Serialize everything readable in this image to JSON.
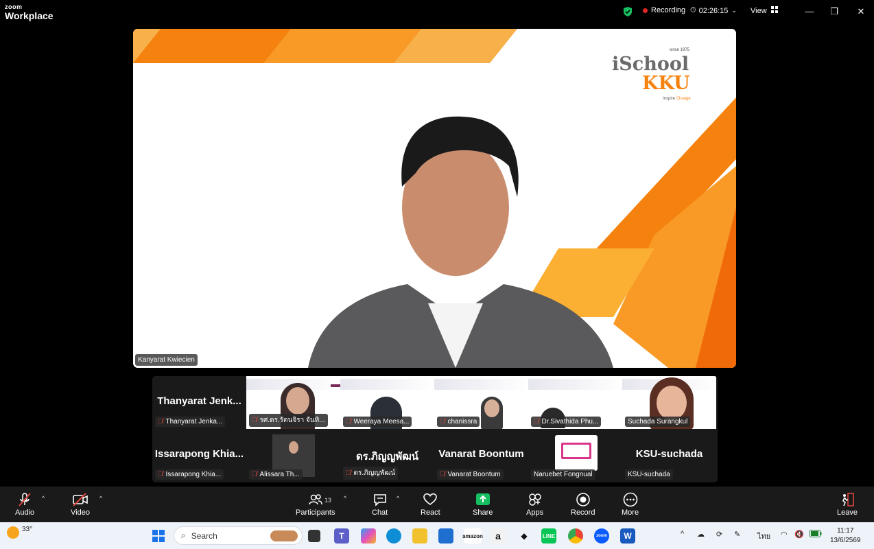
{
  "app": {
    "logo_small": "zoom",
    "logo_big": "Workplace"
  },
  "titlebar": {
    "recording_label": "Recording",
    "timer": "02:26:15",
    "view_label": "View",
    "security_icon": "shield-check-icon"
  },
  "stage": {
    "speaker_name": "Kanyarat Kwiecien",
    "banner": {
      "since": "since 1975",
      "brand1": "iSchool",
      "brand2": "KKU",
      "tagline_a": "Inspire ",
      "tagline_b": "Change"
    }
  },
  "gallery": {
    "tiles": [
      {
        "big": "Thanyarat  Jenk...",
        "label": "Thanyarat  Jenka..."
      },
      {
        "label": "รศ.ดร.รัตนจิรา จันทิ..."
      },
      {
        "label": "Weeraya Meesa..."
      },
      {
        "label": "chanissra"
      },
      {
        "label": "Dr.Sivathida Phu..."
      },
      {
        "label": "Suchada Surangkul"
      },
      {
        "big": "Issarapong  Khia...",
        "label": "Issarapong Khia..."
      },
      {
        "label": "Alissara Th..."
      },
      {
        "big": "ดร.ภิญญพัฒน์",
        "label": "ดร.ภิญญพัฒน์"
      },
      {
        "big": "Vanarat Boontum",
        "label": "Vanarat Boontum"
      },
      {
        "label": "Naruebet Fongnual"
      },
      {
        "big": "KSU-suchada",
        "label": "KSU-suchada"
      }
    ]
  },
  "toolbar": {
    "audio": "Audio",
    "video": "Video",
    "participants": "Participants",
    "participants_count": "13",
    "chat": "Chat",
    "react": "React",
    "share": "Share",
    "apps": "Apps",
    "record": "Record",
    "more": "More",
    "leave": "Leave"
  },
  "taskbar": {
    "temperature": "33°",
    "search_placeholder": "Search",
    "language": "ไทย",
    "time": "11:17",
    "date": "13/6/2569",
    "amazon_label": "amazon"
  },
  "colors": {
    "accent_green": "#16c060",
    "record_red": "#e02828",
    "mute_red": "#e0463f",
    "banner_orange": "#f5820f"
  }
}
